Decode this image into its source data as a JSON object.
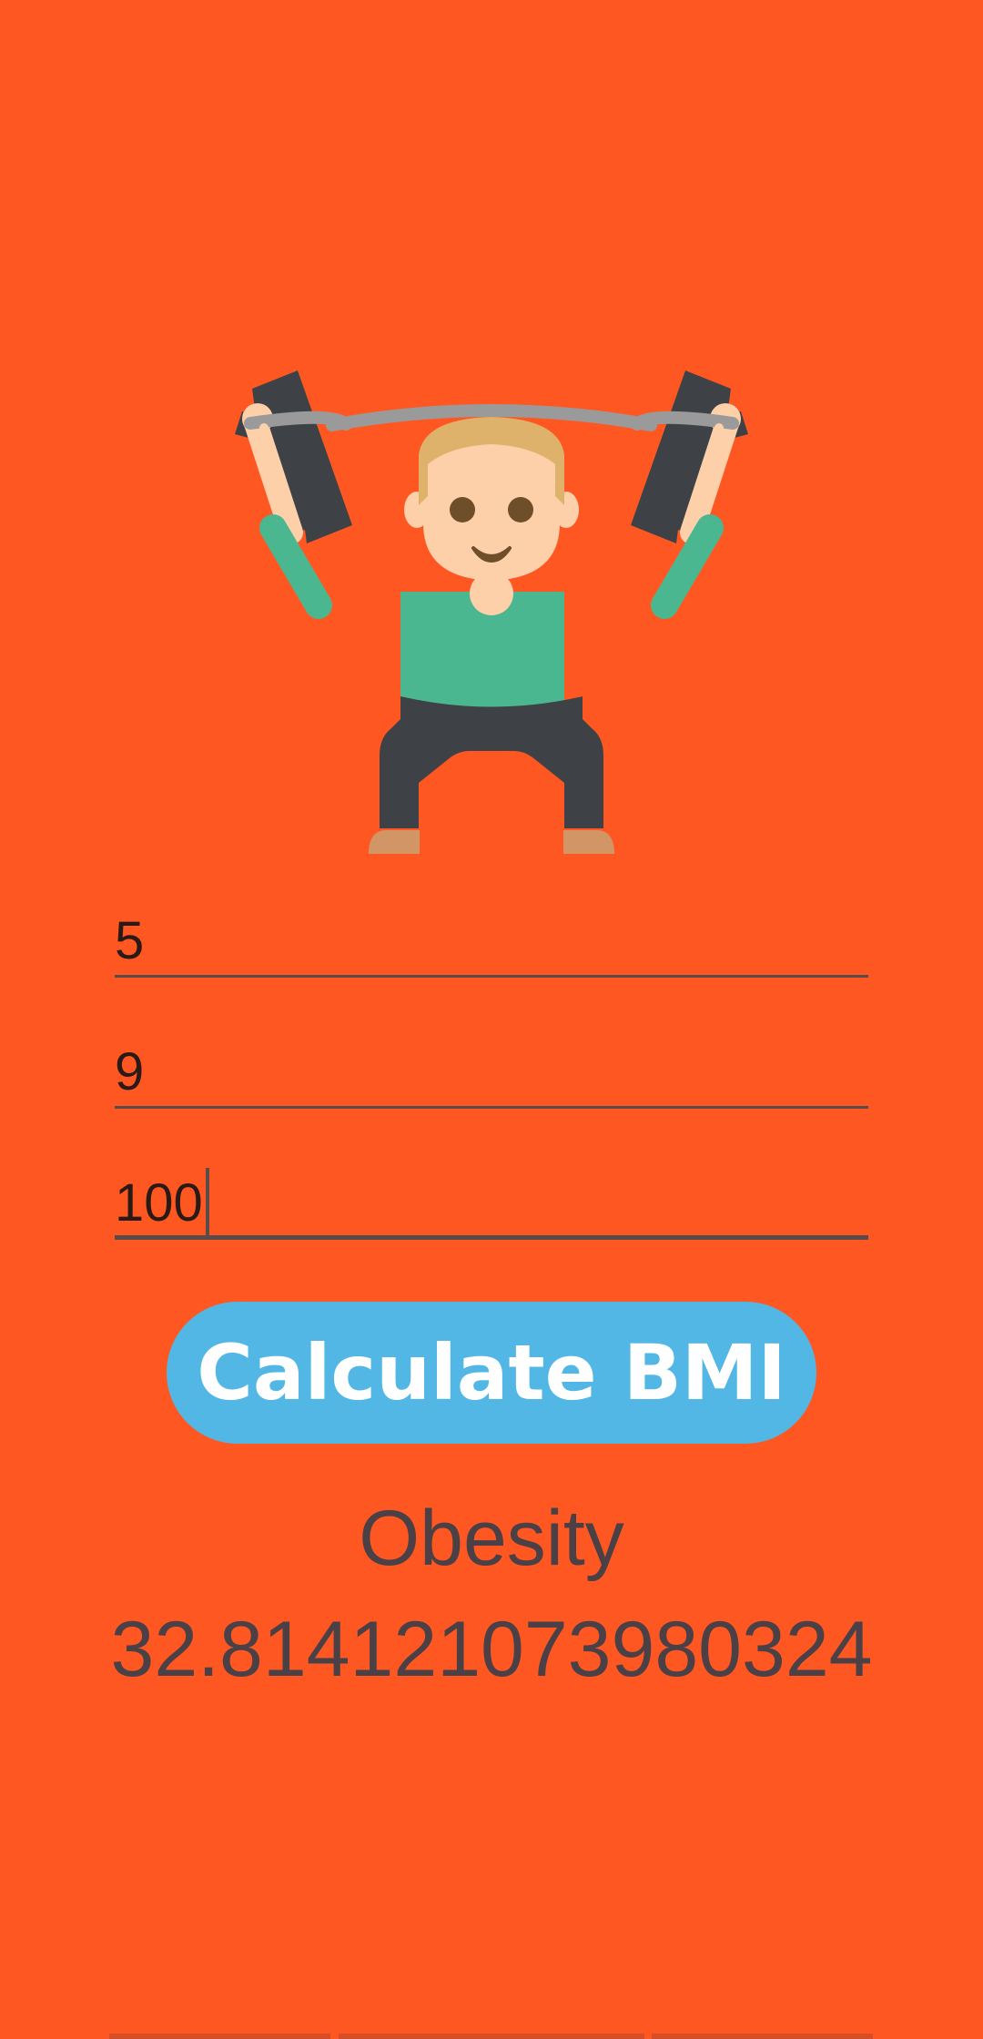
{
  "colors": {
    "background": "#ff5722",
    "input_line": "#5a4a4a",
    "caret": "#5a4a4a",
    "button_bg": "#53b7e5",
    "result_text": "#4a4045",
    "nav_segment": "#b5472a"
  },
  "illustration": {
    "icon": "weightlifter-icon"
  },
  "inputs": [
    {
      "value": "5"
    },
    {
      "value": "9"
    },
    {
      "value": "100",
      "focused": true
    }
  ],
  "button": {
    "label": "Calculate BMI"
  },
  "result": {
    "category": "Obesity",
    "value": "32.814121073980324"
  }
}
